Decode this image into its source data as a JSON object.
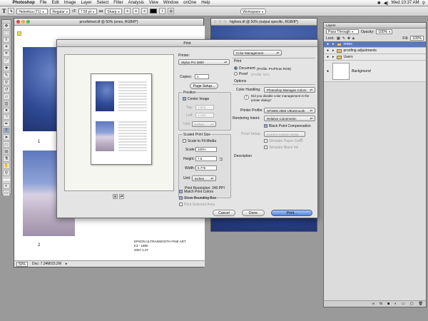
{
  "menubar": {
    "app": "Photoshop",
    "items": [
      "File",
      "Edit",
      "Image",
      "Layer",
      "Select",
      "Filter",
      "Analysis",
      "View",
      "Window",
      "onOne",
      "Help"
    ],
    "clock": "Wed 10:37 AM"
  },
  "options": {
    "font_family": "Helvetica (T1)",
    "font_style": "Regular",
    "font_size": "7.59 pt",
    "antialias": "Sharp",
    "workspace": "Workspace"
  },
  "document": {
    "title": "proofsheet.tif @ 50% (ones, RGB/8*)",
    "page1_num": "1",
    "page2_num": "2",
    "caption": [
      "EPSON ULTRASMOOTH FINE ART",
      "K3 - 1880",
      "2007.1.07"
    ],
    "zoom": "50%",
    "doc_size": "Doc: 7.34M/23.2M"
  },
  "docwin2": {
    "title": "highres.tif @ 50% (output specific, RGB/8*)"
  },
  "layers": {
    "title": "Layers",
    "blend": "Pass Through",
    "opacity_label": "Opacity:",
    "opacity": "100%",
    "lock_label": "Lock:",
    "fill_label": "Fill:",
    "fill": "100%",
    "rows": [
      {
        "name": "notes",
        "type": "folder",
        "selected": true
      },
      {
        "name": "proofing adjustments",
        "type": "folder",
        "selected": false
      },
      {
        "name": "Users",
        "type": "folder",
        "selected": false
      },
      {
        "name": "Background",
        "type": "layer",
        "selected": false
      }
    ]
  },
  "print": {
    "title": "Print",
    "printer_label": "Printer:",
    "printer": "Stylus Pro 3800",
    "copies_label": "Copies:",
    "copies": "1",
    "page_setup": "Page Setup...",
    "position": {
      "legend": "Position",
      "center_image": "Center Image",
      "top_label": "Top:",
      "top": "1.615",
      "left_label": "Left:",
      "left": "1.115",
      "unit_label": "Unit:",
      "unit": "inches"
    },
    "scaled": {
      "legend": "Scaled Print Size",
      "scale_to_fit": "Scale to Fit Media",
      "scale_label": "Scale:",
      "scale": "100%",
      "height_label": "Height:",
      "height": "7.5",
      "width_label": "Width:",
      "width": "5.775",
      "unit_label": "Unit:",
      "unit": "inches",
      "resolution": "Print Resolution: 240 PPI"
    },
    "match_print_colors": "Match Print Colors",
    "show_bounding_box": "Show Bounding Box",
    "print_selected_area": "Print Selected Area",
    "mode": "Color Management",
    "print_section": "Print",
    "document_radio": "Document",
    "document_profile": "(Profile: ProPhoto RGB)",
    "proof_radio": "Proof",
    "proof_profile": "(Profile: N/A)",
    "options_section": "Options",
    "color_handling_label": "Color Handling:",
    "color_handling": "Photoshop Manages Colors",
    "reminder": "Did you disable color management in the printer dialog?",
    "printer_profile_label": "Printer Profile:",
    "printer_profile": "SP3800 2880 UltraSmooth",
    "rendering_label": "Rendering Intent:",
    "rendering": "Relative Colorimetric",
    "bpc": "Black Point Compensation",
    "proof_setup_label": "Proof Setup:",
    "proof_setup": "Current Custom Setup",
    "sim_paper": "Simulate Paper Color",
    "sim_black": "Simulate Black Ink",
    "description": "Description",
    "cancel": "Cancel",
    "done": "Done",
    "print_btn": "Print..."
  }
}
